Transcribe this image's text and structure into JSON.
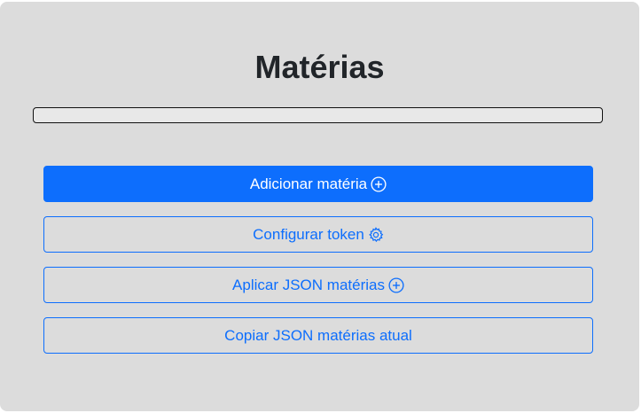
{
  "page": {
    "title": "Matérias"
  },
  "list": {
    "items": []
  },
  "buttons": {
    "add_subject": {
      "label": "Adicionar matéria",
      "icon": "plus-circle-icon"
    },
    "configure_token": {
      "label": "Configurar token",
      "icon": "gear-icon"
    },
    "apply_json": {
      "label": "Aplicar JSON matérias",
      "icon": "plus-circle-icon"
    },
    "copy_json": {
      "label": "Copiar JSON matérias atual"
    }
  },
  "colors": {
    "primary": "#0d6efd",
    "card_background": "#dcdcdc",
    "title_text": "#212529"
  }
}
